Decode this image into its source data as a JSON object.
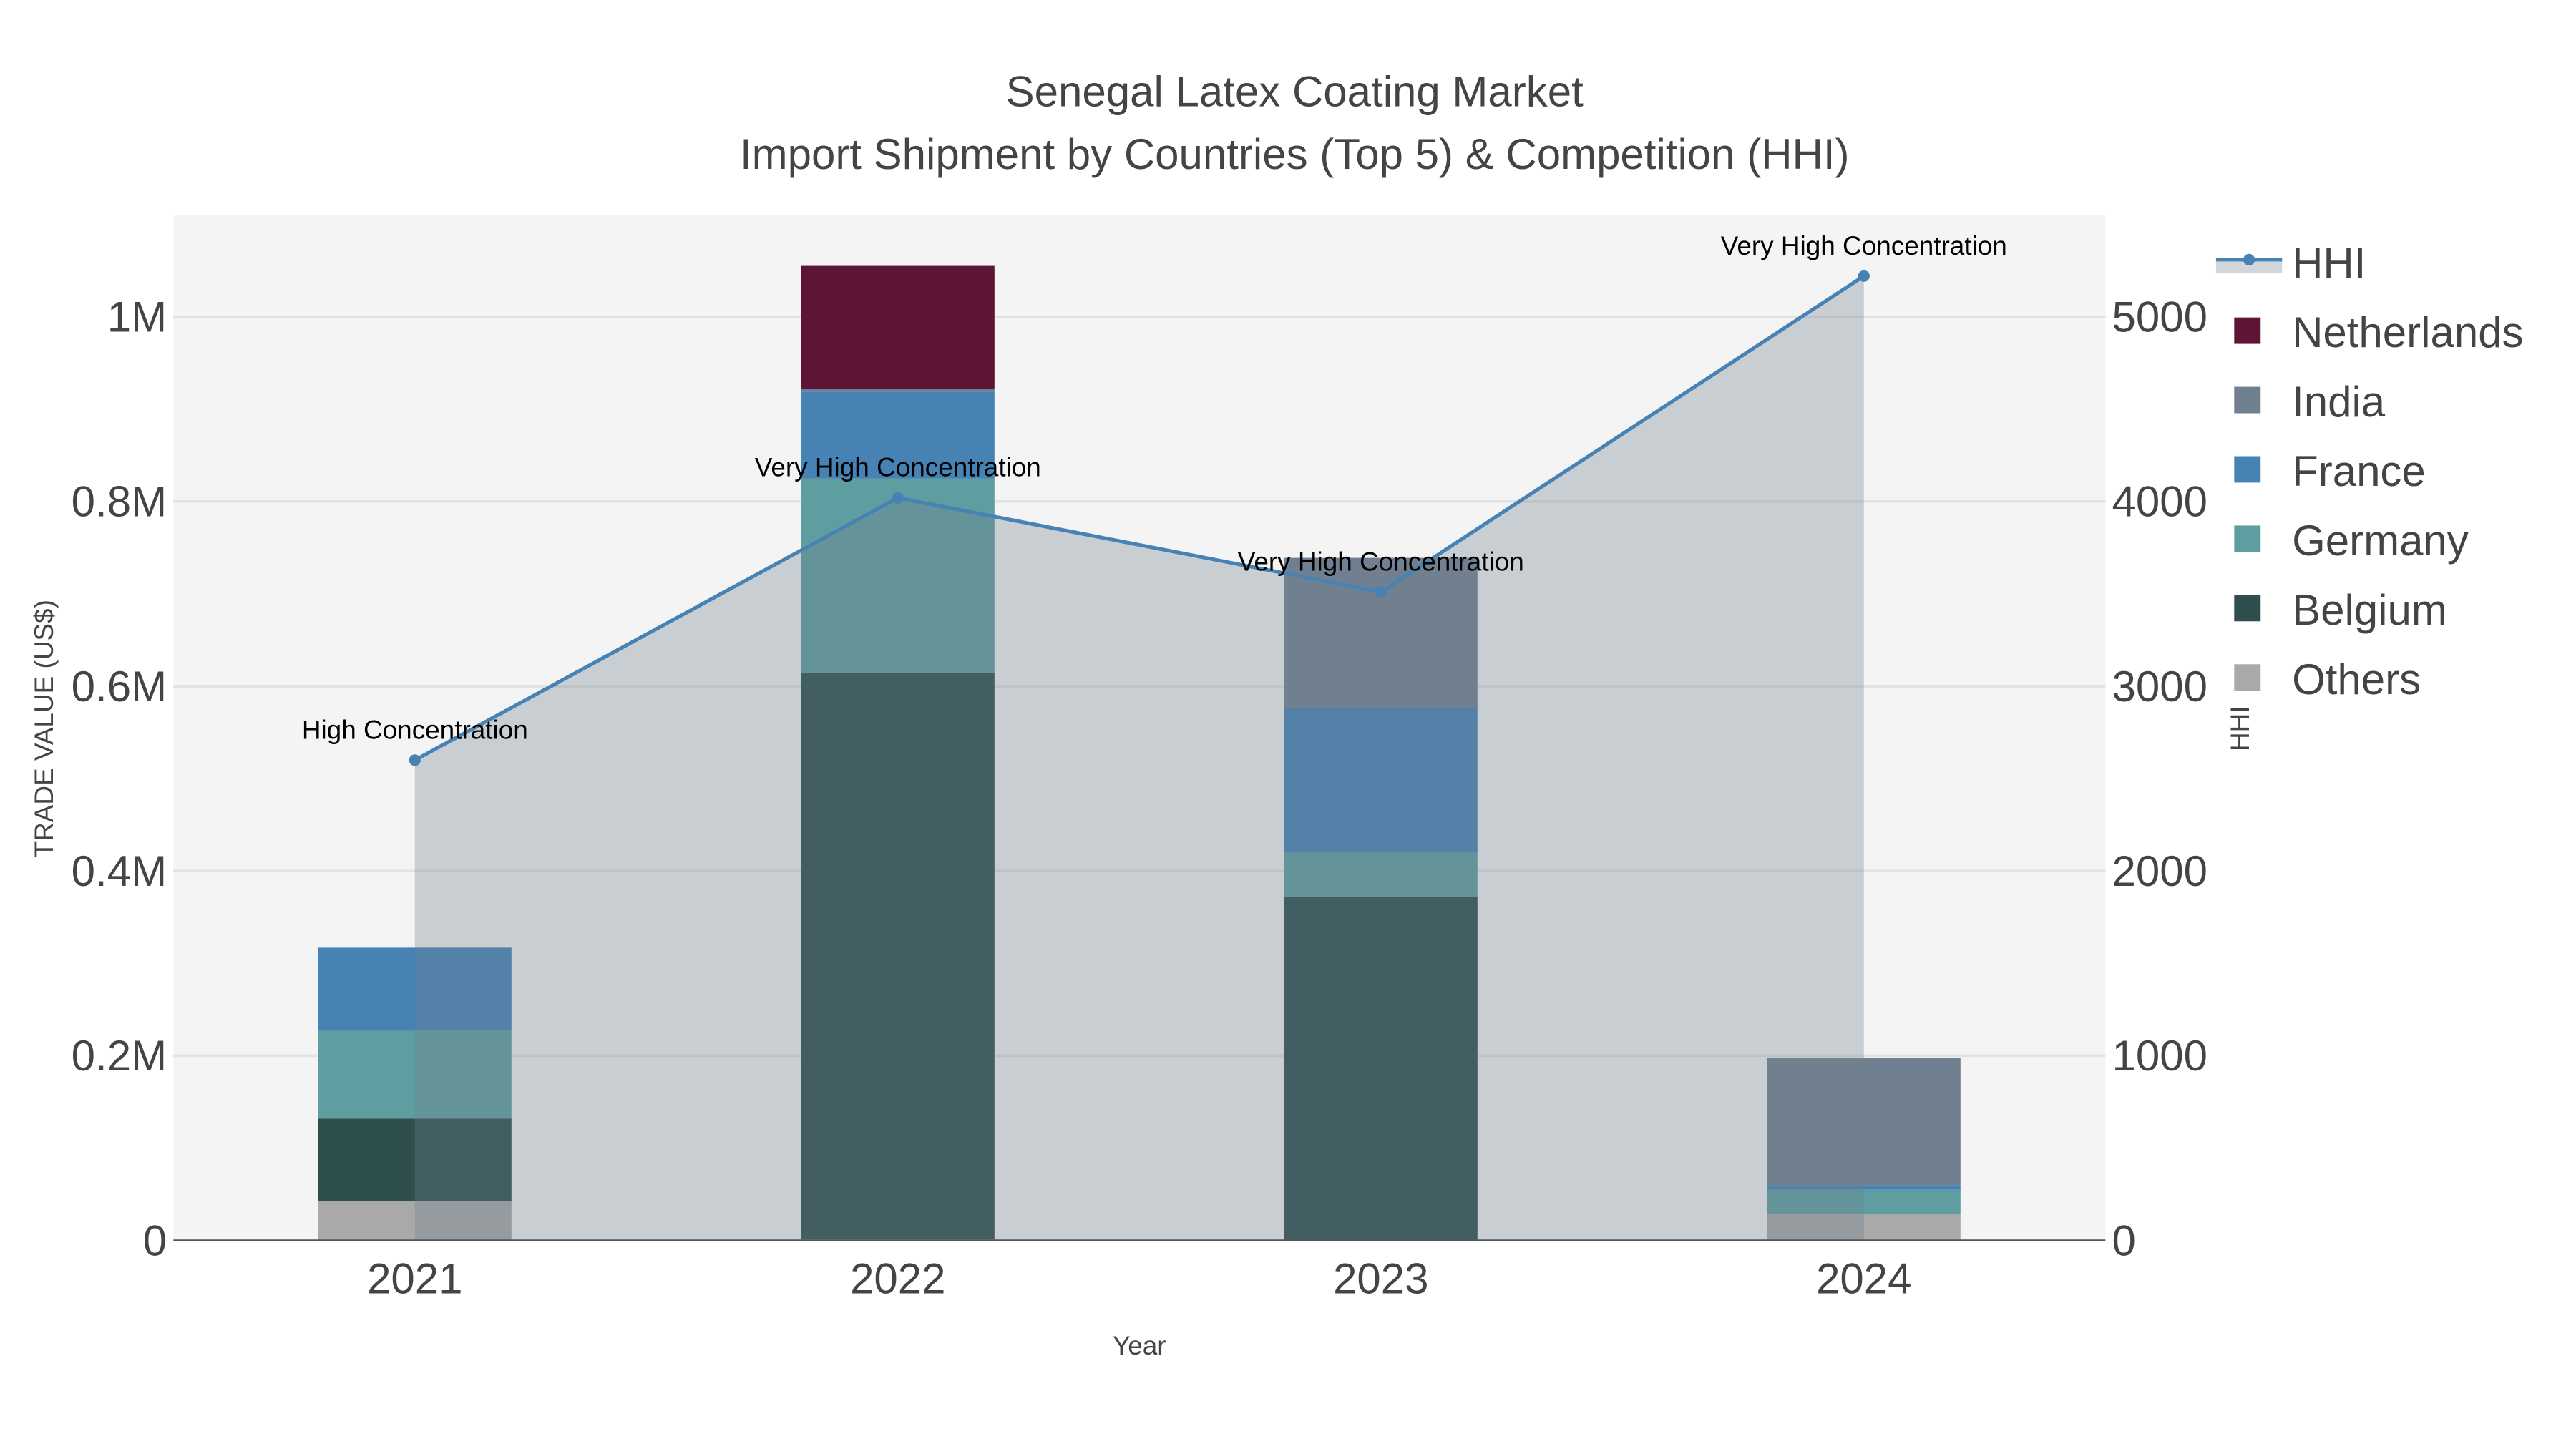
{
  "chart_data": {
    "type": "bar",
    "title": "Senegal Latex Coating Market",
    "subtitle": "Import Shipment by Countries (Top 5) & Competition (HHI)",
    "xlabel": "Year",
    "ylabel": "TRADE VALUE (US$)",
    "y2label": "HHI",
    "categories": [
      "2021",
      "2022",
      "2023",
      "2024"
    ],
    "ylim": [
      0,
      1110000
    ],
    "y2lim": [
      0,
      5550
    ],
    "yticks": [
      {
        "v": 0,
        "label": "0"
      },
      {
        "v": 200000,
        "label": "0.2M"
      },
      {
        "v": 400000,
        "label": "0.4M"
      },
      {
        "v": 600000,
        "label": "0.6M"
      },
      {
        "v": 800000,
        "label": "0.8M"
      },
      {
        "v": 1000000,
        "label": "1M"
      }
    ],
    "y2ticks": [
      {
        "v": 0,
        "label": "0"
      },
      {
        "v": 1000,
        "label": "1000"
      },
      {
        "v": 2000,
        "label": "2000"
      },
      {
        "v": 3000,
        "label": "3000"
      },
      {
        "v": 4000,
        "label": "4000"
      },
      {
        "v": 5000,
        "label": "5000"
      }
    ],
    "grid": true,
    "legend_placement": "right",
    "series": [
      {
        "name": "Others",
        "color": "#a9a9a9",
        "values": [
          43000,
          2000,
          0,
          29000
        ]
      },
      {
        "name": "Belgium",
        "color": "#2f4f4f",
        "values": [
          89000,
          612000,
          372000,
          0
        ]
      },
      {
        "name": "Germany",
        "color": "#5f9ea0",
        "values": [
          95000,
          211000,
          48000,
          26000
        ]
      },
      {
        "name": "France",
        "color": "#4682b4",
        "values": [
          90000,
          94000,
          156000,
          5000
        ]
      },
      {
        "name": "India",
        "color": "#708090",
        "values": [
          0,
          3000,
          163000,
          138000
        ]
      },
      {
        "name": "Netherlands",
        "color": "#5e1434",
        "values": [
          0,
          133000,
          0,
          0
        ]
      }
    ],
    "hhi": {
      "name": "HHI",
      "color": "#4682b4",
      "values": [
        2600,
        4020,
        3510,
        5220
      ],
      "annotations": [
        "High Concentration",
        "Very High Concentration",
        "Very High Concentration",
        "Very High Concentration"
      ]
    },
    "legend_order": [
      "HHI",
      "Netherlands",
      "India",
      "France",
      "Germany",
      "Belgium",
      "Others"
    ]
  }
}
